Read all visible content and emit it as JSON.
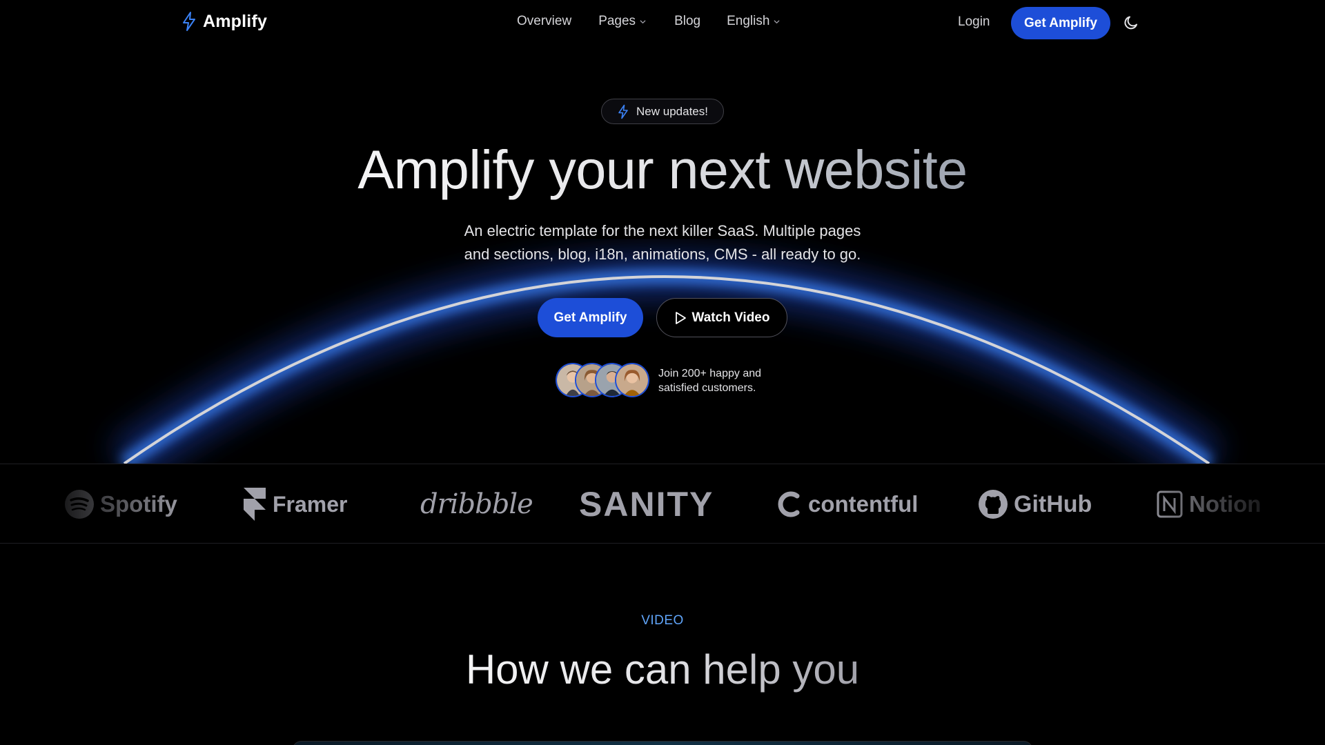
{
  "nav": {
    "brand": "Amplify",
    "links": [
      {
        "label": "Overview",
        "dropdown": false
      },
      {
        "label": "Pages",
        "dropdown": true
      },
      {
        "label": "Blog",
        "dropdown": false
      },
      {
        "label": "English",
        "dropdown": true
      }
    ],
    "login": "Login",
    "cta": "Get Amplify"
  },
  "hero": {
    "badge": "New updates!",
    "title": "Amplify your next website",
    "subtitle_lines": [
      "An electric template for the next killer SaaS. Multiple pages",
      "and sections, blog, i18n, animations, CMS - all ready to go."
    ],
    "primary_cta": "Get Amplify",
    "secondary_cta": "Watch Video",
    "social_proof_lines": [
      "Join 200+ happy and",
      "satisfied customers."
    ]
  },
  "logos": [
    "Spotify",
    "Framer",
    "dribbble",
    "SANITY",
    "contentful",
    "GitHub",
    "Notion"
  ],
  "video_section": {
    "eyebrow": "VIDEO",
    "title": "How we can help you"
  },
  "colors": {
    "accent": "#1d4ed8",
    "eyebrow": "#60a5fa",
    "glow": "#3b82f6",
    "background": "#000000"
  }
}
